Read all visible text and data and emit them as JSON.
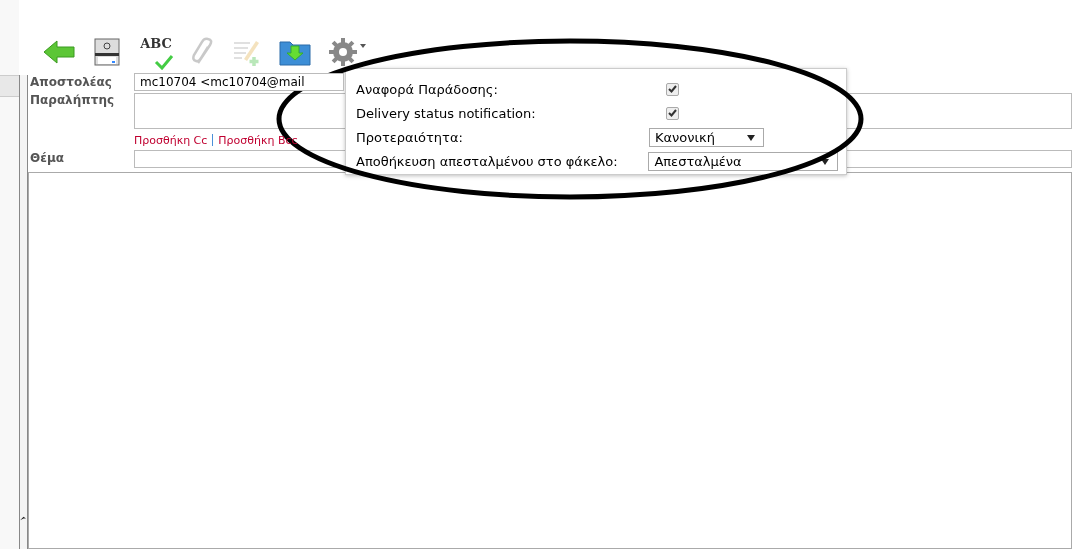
{
  "toolbar": [
    {
      "kind": "back",
      "disabled": false
    },
    {
      "kind": "print",
      "disabled": false
    },
    {
      "kind": "spell",
      "label": "ABC",
      "disabled": false
    },
    {
      "kind": "attach",
      "disabled": true
    },
    {
      "kind": "signature",
      "disabled": true
    },
    {
      "kind": "save",
      "disabled": false
    },
    {
      "kind": "options",
      "disabled": false
    }
  ],
  "form": {
    "from_label": "Αποστολέας",
    "from_value": "mc10704 <mc10704@mail",
    "to_label": "Παραλήπτης",
    "links": [
      "Προσθήκη Cc",
      "Προσθήκη Bcc"
    ],
    "subject_label": "Θέμα"
  },
  "options_popup": {
    "rows": [
      {
        "kind": "checkbox",
        "label": "Αναφορά Παράδοσης:",
        "checked": true
      },
      {
        "kind": "checkbox",
        "label": "Delivery status notification:",
        "checked": true
      },
      {
        "kind": "select",
        "label": "Προτεραιότητα:",
        "value": "Κανονική"
      },
      {
        "kind": "select",
        "label": "Αποθήκευση απεσταλμένου στο φάκελο:",
        "value": "Απεσταλμένα"
      }
    ]
  }
}
